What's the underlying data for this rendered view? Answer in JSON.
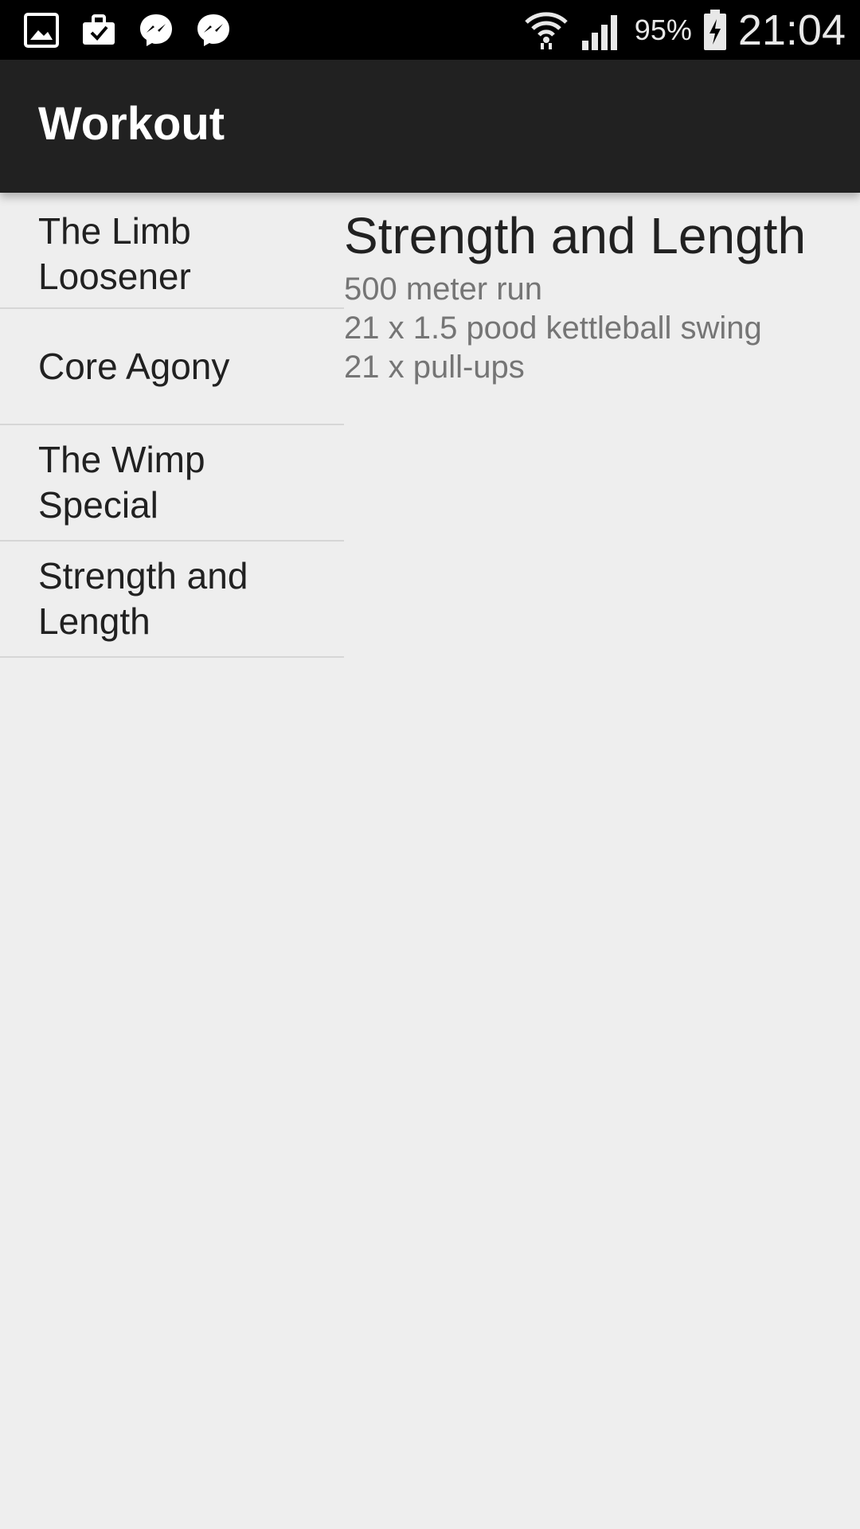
{
  "status_bar": {
    "notification_icons": [
      "gallery-icon",
      "briefcase-check-icon",
      "messenger-icon",
      "messenger-icon"
    ],
    "battery_percent": "95%",
    "time": "21:04"
  },
  "app_bar": {
    "title": "Workout"
  },
  "workouts": [
    {
      "name": "The Limb Loosener"
    },
    {
      "name": "Core Agony"
    },
    {
      "name": "The Wimp Special"
    },
    {
      "name": "Strength and Length"
    }
  ],
  "detail": {
    "title": "Strength and Length",
    "steps": [
      "500 meter run",
      "21 x 1.5 pood kettleball swing",
      "21 x pull-ups"
    ]
  }
}
